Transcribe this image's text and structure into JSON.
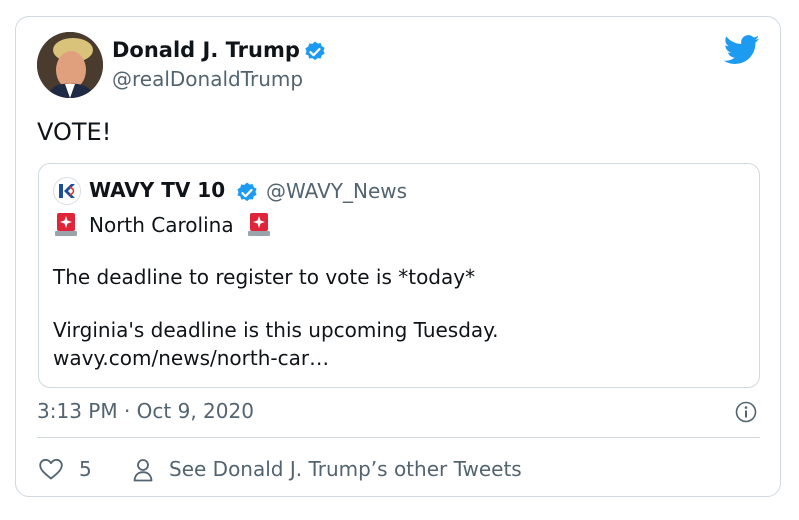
{
  "tweet": {
    "author_name": "Donald J. Trump",
    "author_handle": "@realDonaldTrump",
    "text": "VOTE!",
    "timestamp": "3:13 PM · Oct 9, 2020",
    "likes": "5",
    "other_tweets_link": "See Donald J. Trump’s other Tweets"
  },
  "quote": {
    "author_name": "WAVY TV 10",
    "author_handle": "@WAVY_News",
    "line1": "North Carolina",
    "line2": "The deadline to register to vote is *today*",
    "line3": "Virginia's deadline is this upcoming Tuesday.",
    "line4": "wavy.com/news/north-car…"
  },
  "colors": {
    "twitter_blue": "#1d9bf0",
    "border": "#cfd9de",
    "secondary_text": "#536471",
    "siren_red": "#e0253a"
  },
  "icons": [
    "twitter-bird-icon",
    "verified-badge-icon",
    "police-siren-emoji-icon",
    "info-icon",
    "heart-icon",
    "person-icon"
  ]
}
